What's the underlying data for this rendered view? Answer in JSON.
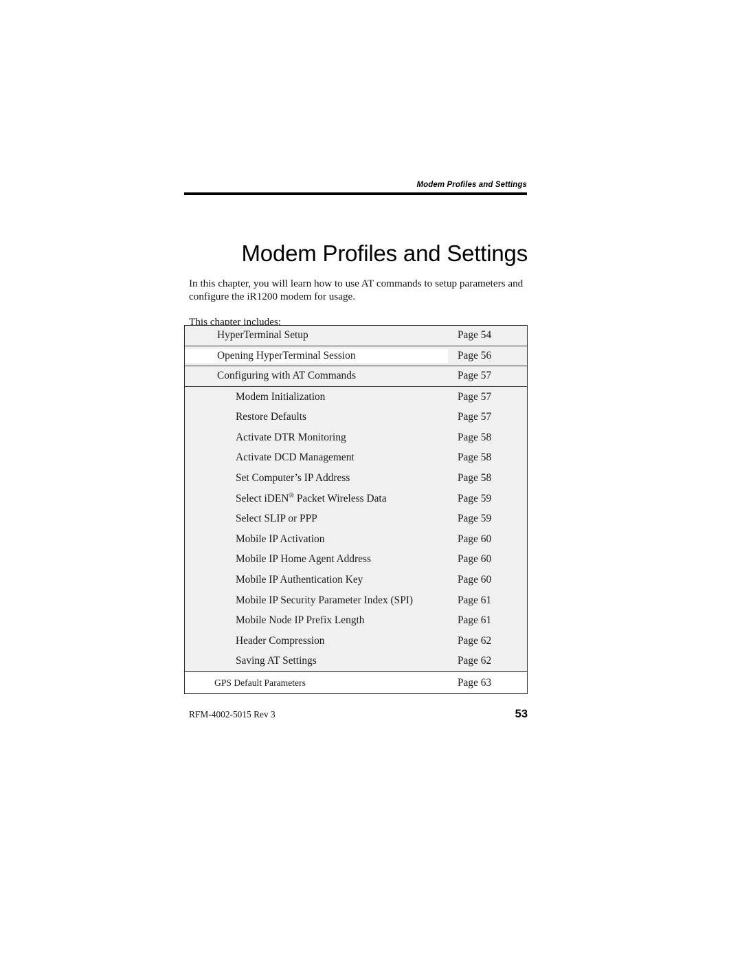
{
  "header": {
    "running_title": "Modem Profiles and Settings"
  },
  "title": "Modem Profiles and Settings",
  "intro": {
    "paragraph": "In this chapter, you will learn how to use AT commands to setup parameters and configure the iR1200 modem for usage.",
    "includes_label": "This chapter includes:"
  },
  "toc": {
    "rows": [
      {
        "label": "HyperTerminal Setup",
        "page": "Page 54",
        "level": 1
      },
      {
        "label": "Opening HyperTerminal Session",
        "page": "Page 56",
        "level": 1
      },
      {
        "label": "Configuring with AT Commands",
        "page": "Page 57",
        "level": 1
      },
      {
        "label": "Modem Initialization",
        "page": "Page 57",
        "level": 2
      },
      {
        "label": "Restore Defaults",
        "page": "Page 57",
        "level": 2
      },
      {
        "label": "Activate DTR Monitoring",
        "page": "Page 58",
        "level": 2
      },
      {
        "label": "Activate DCD Management",
        "page": "Page 58",
        "level": 2
      },
      {
        "label": "Set Computer’s IP Address",
        "page": "Page 58",
        "level": 2
      },
      {
        "label": "Select iDEN® Packet Wireless Data",
        "page": "Page 59",
        "level": 2
      },
      {
        "label": "Select SLIP or PPP",
        "page": "Page 59",
        "level": 2
      },
      {
        "label": "Mobile IP Activation",
        "page": "Page 60",
        "level": 2
      },
      {
        "label": "Mobile IP Home Agent Address",
        "page": "Page 60",
        "level": 2
      },
      {
        "label": "Mobile IP Authentication Key",
        "page": "Page 60",
        "level": 2
      },
      {
        "label": "Mobile IP Security Parameter Index (SPI)",
        "page": "Page 61",
        "level": 2
      },
      {
        "label": "Mobile Node IP Prefix Length",
        "page": "Page 61",
        "level": 2
      },
      {
        "label": "Header Compression",
        "page": "Page 62",
        "level": 2
      },
      {
        "label": "Saving AT Settings",
        "page": "Page 62",
        "level": 2
      },
      {
        "label": "GPS Default Parameters",
        "page": "Page 63",
        "level": 0
      }
    ]
  },
  "footer": {
    "document_id": "RFM-4002-5015 Rev 3",
    "page_number": "53"
  },
  "colors": {
    "page_background": "#ffffff",
    "table_background": "#f0f0f0",
    "rule": "#000000",
    "text": "#111111"
  }
}
